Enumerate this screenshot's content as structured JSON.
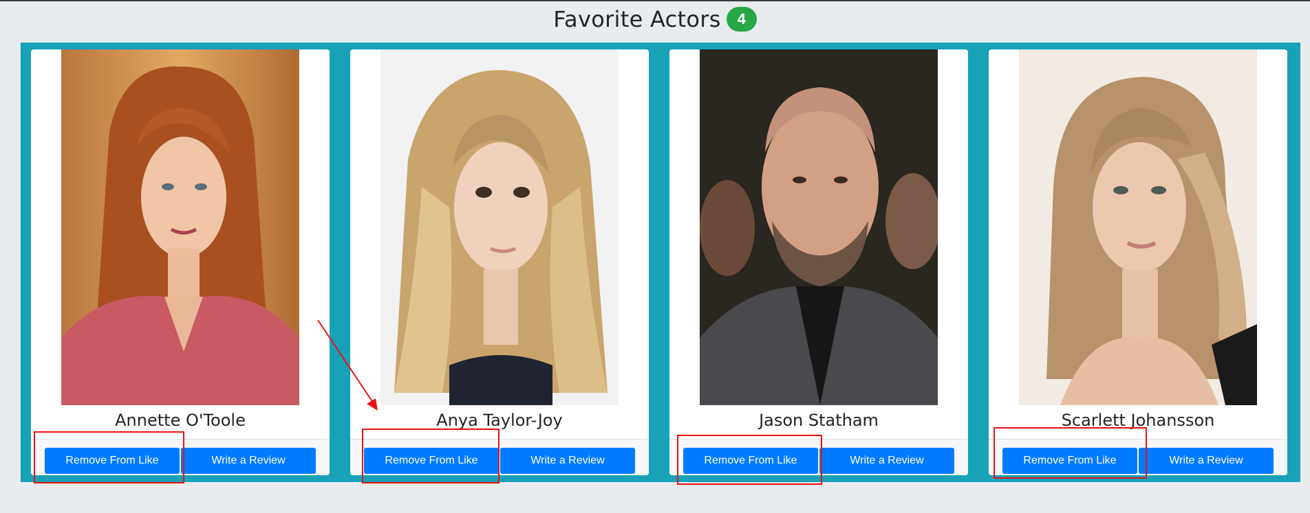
{
  "header": {
    "title": "Favorite Actors",
    "count": "4"
  },
  "actors": [
    {
      "name": "Annette O'Toole",
      "remove_label": "Remove From Like",
      "review_label": "Write a Review"
    },
    {
      "name": "Anya Taylor-Joy",
      "remove_label": "Remove From Like",
      "review_label": "Write a Review"
    },
    {
      "name": "Jason Statham",
      "remove_label": "Remove From Like",
      "review_label": "Write a Review"
    },
    {
      "name": "Scarlett Johansson",
      "remove_label": "Remove From Like",
      "review_label": "Write a Review"
    }
  ],
  "colors": {
    "board": "#17a2b8",
    "button": "#007bff",
    "badge": "#28a745",
    "annotation": "#ee1111"
  }
}
